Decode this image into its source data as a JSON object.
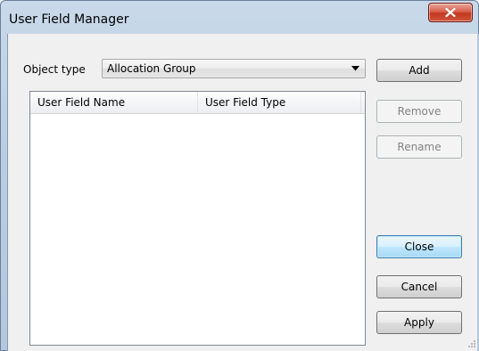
{
  "window": {
    "title": "User Field Manager",
    "close_glyph": "X",
    "close_icon": "close-icon"
  },
  "object_type": {
    "label": "Object type",
    "value": "Allocation Group",
    "dropdown_icon": "chevron-down-icon"
  },
  "list": {
    "columns": [
      "User Field Name",
      "User Field Type"
    ],
    "rows": []
  },
  "buttons": {
    "add": "Add",
    "remove": "Remove",
    "rename": "Rename",
    "close": "Close",
    "cancel": "Cancel",
    "apply": "Apply"
  },
  "colors": {
    "close_button": "#c3381f",
    "default_button_border": "#3c7fb1",
    "disabled_text": "#838383"
  }
}
